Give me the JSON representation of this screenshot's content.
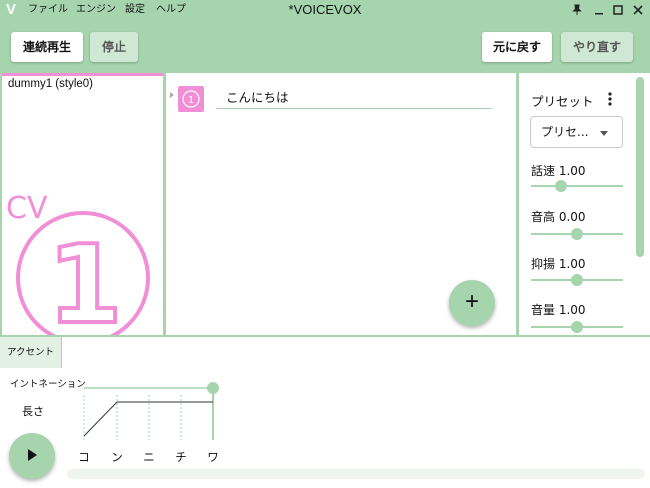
{
  "app": {
    "logo": "V",
    "title": "*VOICEVOX",
    "menus": [
      "ファイル",
      "エンジン",
      "設定",
      "ヘルプ"
    ],
    "window_icons": [
      "pin-icon",
      "minimize-icon",
      "maximize-icon",
      "close-icon"
    ]
  },
  "toolbar": {
    "play_continuous": "連続再生",
    "stop": "停止",
    "undo": "元に戻す",
    "redo": "やり直す"
  },
  "character": {
    "name": "dummy1 (style0)",
    "art_text": "CV",
    "art_number": "1"
  },
  "audio": {
    "rows": [
      {
        "text": "こんにちは",
        "icon": "character-icon"
      }
    ],
    "add_button": "+"
  },
  "params": {
    "preset_label": "プリセット",
    "preset_select": "プリセ...",
    "items": [
      {
        "label": "話速",
        "value": "1.00",
        "level": 0.33
      },
      {
        "label": "音高",
        "value": "0.00",
        "level": 0.5
      },
      {
        "label": "抑揚",
        "value": "1.00",
        "level": 0.5
      },
      {
        "label": "音量",
        "value": "1.00",
        "level": 0.5
      }
    ]
  },
  "editor": {
    "tab": "アクセント",
    "intonation_label": "イントネーション",
    "length_label": "長さ",
    "moras": [
      "コ",
      "ン",
      "ニ",
      "チ",
      "ワ"
    ]
  },
  "colors": {
    "primary": "#a5d4ad",
    "accent_pink": "#f08fd6"
  }
}
